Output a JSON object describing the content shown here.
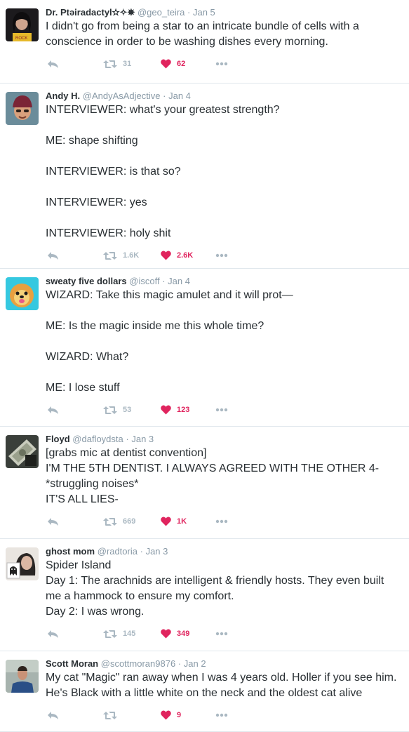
{
  "colors": {
    "text": "#292f33",
    "meta": "#8899a6",
    "action_icon": "#aab8c2",
    "like": "#e0245e",
    "divider": "#e1e8ed"
  },
  "tweets": [
    {
      "fullname": "Dr. Ptəiradactyl✫✧✵",
      "username": "@geo_teira",
      "sep": "·",
      "time": "Jan 5",
      "lines": [
        "I didn't go from being a star to an intricate bundle of cells with a conscience in order to be washing dishes every morning."
      ],
      "retweets": "31",
      "likes": "62",
      "avatar_icon": "dark-haired-woman-avatar"
    },
    {
      "fullname": "Andy H.",
      "username": "@AndyAsAdjective",
      "sep": "·",
      "time": "Jan 4",
      "lines": [
        "INTERVIEWER: what's your greatest strength?",
        "",
        "ME: shape shifting",
        "",
        "INTERVIEWER: is that so?",
        "",
        "INTERVIEWER: yes",
        "",
        "INTERVIEWER: holy shit"
      ],
      "retweets": "1.6K",
      "likes": "2.6K",
      "avatar_icon": "man-in-beanie-avatar"
    },
    {
      "fullname": "sweaty five dollars",
      "username": "@iscoff",
      "sep": "·",
      "time": "Jan 4",
      "lines": [
        "WIZARD: Take this magic amulet and it will prot—",
        "",
        "ME: Is the magic inside me this whole time?",
        "",
        "WIZARD: What?",
        "",
        "ME: I lose stuff"
      ],
      "retweets": "53",
      "likes": "123",
      "avatar_icon": "pomeranian-dog-avatar"
    },
    {
      "fullname": "Floyd",
      "username": "@dafloydsta",
      "sep": "·",
      "time": "Jan 3",
      "lines": [
        "[grabs mic at dentist convention]",
        "I'M THE 5TH DENTIST. I ALWAYS AGREED WITH THE OTHER 4-",
        "*struggling noises*",
        "IT'S ALL LIES-"
      ],
      "retweets": "669",
      "likes": "1K",
      "avatar_icon": "dollar-bills-avatar"
    },
    {
      "fullname": "ghost mom",
      "username": "@radtoria",
      "sep": "·",
      "time": "Jan 3",
      "lines": [
        "Spider Island",
        "Day 1: The arachnids are intelligent & friendly hosts. They even built me a hammock to ensure my comfort.",
        "Day 2: I was wrong."
      ],
      "retweets": "145",
      "likes": "349",
      "avatar_icon": "woman-with-ghost-avatar"
    },
    {
      "fullname": "Scott Moran",
      "username": "@scottmoran9876",
      "sep": "·",
      "time": "Jan 2",
      "lines": [
        "My cat \"Magic\" ran away when I was 4 years old. Holler if you see him. He's Black with a little white on the neck and the oldest cat alive"
      ],
      "retweets": "",
      "likes": "9",
      "avatar_icon": "man-in-blue-shirt-avatar"
    }
  ]
}
